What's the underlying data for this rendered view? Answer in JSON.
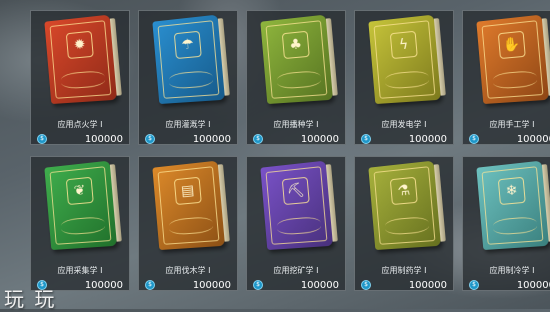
{
  "currency_icon": "coin-icon",
  "rows": [
    [
      {
        "label": "应用点火学 I",
        "price": "100000",
        "book_color": "#d9482a",
        "edge_color": "#8f2a18",
        "icon": "flame-icon",
        "glyph": "✹"
      },
      {
        "label": "应用灌溉学 I",
        "price": "100000",
        "book_color": "#2a8fd0",
        "edge_color": "#165a8a",
        "icon": "watering-can-icon",
        "glyph": "☂"
      },
      {
        "label": "应用播种学 I",
        "price": "100000",
        "book_color": "#8fb63d",
        "edge_color": "#567321",
        "icon": "sprout-icon",
        "glyph": "♣"
      },
      {
        "label": "应用发电学 I",
        "price": "100000",
        "book_color": "#c6c43a",
        "edge_color": "#7d7a1d",
        "icon": "lightning-icon",
        "glyph": "ϟ"
      },
      {
        "label": "应用手工学 I",
        "price": "100000",
        "book_color": "#e07b2c",
        "edge_color": "#8e4615",
        "icon": "hand-icon",
        "glyph": "✋"
      }
    ],
    [
      {
        "label": "应用采集学 I",
        "price": "100000",
        "book_color": "#3fae4d",
        "edge_color": "#21702b",
        "icon": "leaf-icon",
        "glyph": "❦"
      },
      {
        "label": "应用伐木学 I",
        "price": "100000",
        "book_color": "#dd8a2a",
        "edge_color": "#8c5015",
        "icon": "logs-icon",
        "glyph": "▤"
      },
      {
        "label": "应用挖矿学 I",
        "price": "100000",
        "book_color": "#7a52c8",
        "edge_color": "#48307c",
        "icon": "pickaxe-icon",
        "glyph": "⛏"
      },
      {
        "label": "应用制药学 I",
        "price": "100000",
        "book_color": "#a7b13c",
        "edge_color": "#66701f",
        "icon": "mortar-icon",
        "glyph": "⚗"
      },
      {
        "label": "应用制冷学 I",
        "price": "100000",
        "book_color": "#6ec2c0",
        "edge_color": "#3a807e",
        "icon": "snowflake-icon",
        "glyph": "❄"
      }
    ]
  ],
  "watermark_text": "玩  玩"
}
